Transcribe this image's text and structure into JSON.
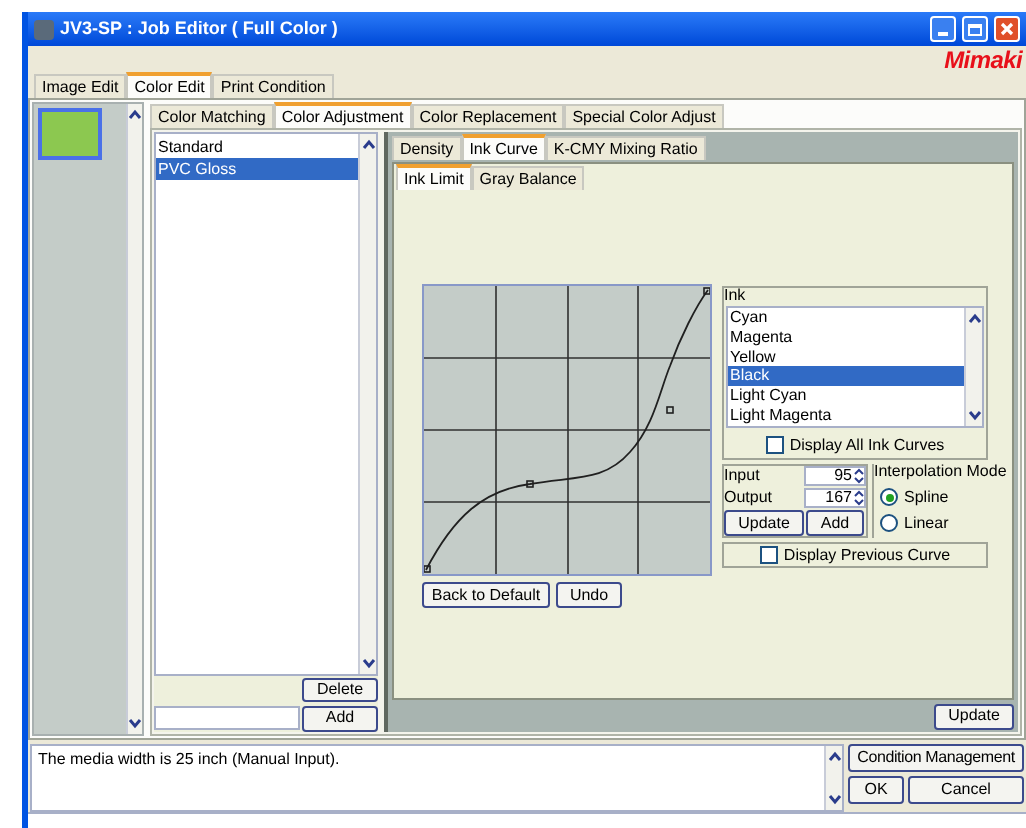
{
  "window": {
    "title": "JV3-SP : Job Editor ( Full Color )"
  },
  "logo": "Mimaki",
  "main_tabs": [
    {
      "label": "Image Edit",
      "selected": false
    },
    {
      "label": "Color Edit",
      "selected": true
    },
    {
      "label": "Print Condition",
      "selected": false
    }
  ],
  "sub_tabs": [
    {
      "label": "Color Matching",
      "selected": false
    },
    {
      "label": "Color Adjustment",
      "selected": true
    },
    {
      "label": "Color Replacement",
      "selected": false
    },
    {
      "label": "Special Color Adjust",
      "selected": false
    }
  ],
  "conditions": [
    {
      "label": "Standard",
      "selected": false
    },
    {
      "label": "PVC Gloss",
      "selected": true
    }
  ],
  "condition_buttons": {
    "delete": "Delete",
    "add": "Add"
  },
  "adjust_tabs": [
    {
      "label": "Density",
      "selected": false
    },
    {
      "label": "Ink Curve",
      "selected": true
    },
    {
      "label": "K-CMY Mixing Ratio",
      "selected": false
    }
  ],
  "curve_tabs": [
    {
      "label": "Ink Limit",
      "selected": true
    },
    {
      "label": "Gray Balance",
      "selected": false
    }
  ],
  "ink": {
    "label": "Ink",
    "items": [
      {
        "label": "Cyan",
        "selected": false
      },
      {
        "label": "Magenta",
        "selected": false
      },
      {
        "label": "Yellow",
        "selected": false
      },
      {
        "label": "Black",
        "selected": true
      },
      {
        "label": "Light Cyan",
        "selected": false
      },
      {
        "label": "Light Magenta",
        "selected": false
      }
    ]
  },
  "display_all": {
    "label": "Display All Ink Curves",
    "checked": false
  },
  "point": {
    "input_label": "Input",
    "input": "95",
    "output_label": "Output",
    "output": "167",
    "update": "Update",
    "add": "Add"
  },
  "interpolation": {
    "label": "Interpolation Mode",
    "options": [
      {
        "label": "Spline",
        "selected": true
      },
      {
        "label": "Linear",
        "selected": false
      }
    ]
  },
  "display_previous": {
    "label": "Display Previous Curve",
    "checked": false
  },
  "chart_buttons": {
    "back": "Back to Default",
    "undo": "Undo"
  },
  "update": "Update",
  "message": "The media width is 25 inch (Manual Input).",
  "bottom_buttons": {
    "condition": "Condition Management",
    "ok": "OK",
    "cancel": "Cancel"
  }
}
